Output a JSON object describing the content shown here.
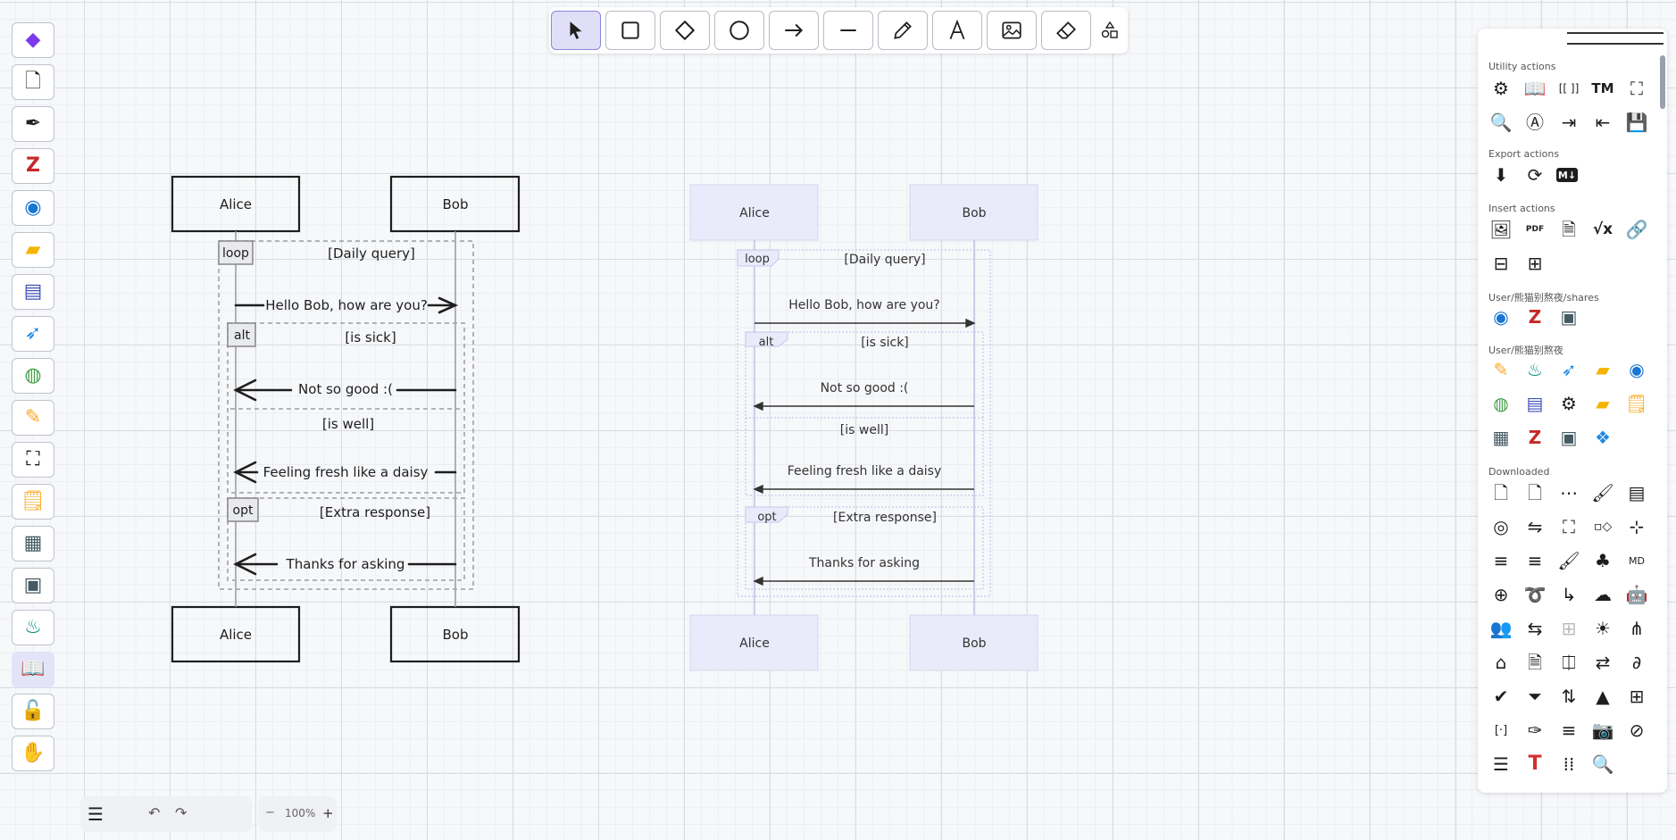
{
  "toolbar": {
    "tools": [
      {
        "id": "selection",
        "icon": "pointer-icon"
      },
      {
        "id": "rectangle",
        "icon": "square-icon"
      },
      {
        "id": "diamond",
        "icon": "diamond-icon"
      },
      {
        "id": "ellipse",
        "icon": "circle-icon"
      },
      {
        "id": "arrow",
        "icon": "arrow-icon"
      },
      {
        "id": "line",
        "icon": "line-icon"
      },
      {
        "id": "draw",
        "icon": "pencil-icon"
      },
      {
        "id": "text",
        "icon": "text-icon"
      },
      {
        "id": "image",
        "icon": "image-icon"
      },
      {
        "id": "eraser",
        "icon": "eraser-icon"
      },
      {
        "id": "more-shapes",
        "icon": "shapes-icon"
      }
    ],
    "selected": "selection"
  },
  "dock": {
    "items": [
      "obsidian-icon",
      "new-file-icon",
      "pen-icon",
      "zotero-icon",
      "edge-icon",
      "folder-icon",
      "app-icon",
      "bird-icon",
      "chrome-icon",
      "highlighter-icon",
      "frame-icon",
      "notes-icon",
      "slides-icon",
      "monitor-icon",
      "painter-icon",
      "book-icon",
      "unlock-icon",
      "hand-icon"
    ]
  },
  "bottom": {
    "menu_icon": "hamburger-icon",
    "undo": "undo-icon",
    "redo": "redo-icon",
    "zoom_out": "−",
    "zoom": "100%",
    "zoom_in": "+"
  },
  "panel": {
    "sections": [
      {
        "title": "Utility actions"
      },
      {
        "title": "Export actions"
      },
      {
        "title": "Insert actions"
      },
      {
        "title": "User/熊猫别熬夜/shares"
      },
      {
        "title": "User/熊猫别熬夜"
      },
      {
        "title": "Downloaded"
      }
    ],
    "utility_glyphs": [
      "⚙",
      "📖",
      "[[ ]]",
      "TM",
      "⛶",
      "🔍",
      "A",
      "⇥",
      "⇥",
      "💾"
    ],
    "export_glyphs": [
      "⬇",
      "⟳",
      "M↓"
    ],
    "insert_glyphs": [
      "🖼",
      "PDF",
      "🗎",
      "√x",
      "🔗",
      "⊟",
      "⊞"
    ]
  },
  "diagram_sketch": {
    "participants": [
      "Alice",
      "Bob"
    ],
    "blocks": [
      {
        "kind": "loop",
        "label": "[Daily query]"
      },
      {
        "kind": "alt",
        "label": "[is sick]"
      },
      {
        "kind": "else",
        "label": "[is well]"
      },
      {
        "kind": "opt",
        "label": "[Extra response]"
      }
    ],
    "messages": [
      "Hello Bob, how are you?",
      "Not so good :(",
      "Feeling fresh like a daisy",
      "Thanks for asking"
    ]
  },
  "diagram_clean": {
    "participants": [
      "Alice",
      "Bob"
    ],
    "blocks": [
      {
        "kind": "loop",
        "label": "[Daily query]"
      },
      {
        "kind": "alt",
        "label": "[is sick]"
      },
      {
        "kind": "else",
        "label": "[is well]"
      },
      {
        "kind": "opt",
        "label": "[Extra response]"
      }
    ],
    "messages": [
      "Hello Bob, how are you?",
      "Not so good :(",
      "Feeling fresh like a daisy",
      "Thanks for asking"
    ]
  }
}
